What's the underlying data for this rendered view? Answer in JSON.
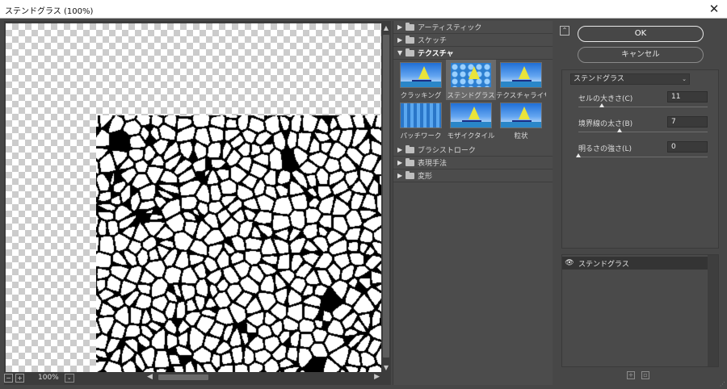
{
  "window": {
    "title": "ステンドグラス (100%)",
    "close": "✕"
  },
  "preview": {
    "zoom": "100%",
    "minus": "−",
    "plus": "+",
    "zoom_dropdown": "⌄"
  },
  "gallery": {
    "categories": [
      {
        "label": "アーティスティック",
        "state": "collapsed"
      },
      {
        "label": "スケッチ",
        "state": "collapsed"
      },
      {
        "label": "テクスチャ",
        "state": "expanded"
      },
      {
        "label": "ブラシストローク",
        "state": "collapsed"
      },
      {
        "label": "表現手法",
        "state": "collapsed"
      },
      {
        "label": "変形",
        "state": "collapsed"
      }
    ],
    "texture_filters": [
      {
        "label": "クラッキング"
      },
      {
        "label": "ステンドグラス",
        "selected": true
      },
      {
        "label": "テクスチャライザー"
      },
      {
        "label": "パッチワーク"
      },
      {
        "label": "モザイクタイル"
      },
      {
        "label": "粒状"
      }
    ]
  },
  "buttons": {
    "ok": "OK",
    "cancel": "キャンセル",
    "collapse": "⌃"
  },
  "settings": {
    "filter": "ステンドグラス",
    "params": [
      {
        "label": "セルの大きさ(C)",
        "value": "11",
        "fraction": 0.18
      },
      {
        "label": "境界線の太さ(B)",
        "value": "7",
        "fraction": 0.32
      },
      {
        "label": "明るさの強さ(L)",
        "value": "0",
        "fraction": 0.0
      }
    ]
  },
  "layers": {
    "items": [
      {
        "label": "ステンドグラス",
        "visible": true
      }
    ]
  },
  "icons": {
    "new_layer": "new-effect-layer-icon",
    "delete_layer": "trash-icon",
    "eye": "eye-icon"
  }
}
